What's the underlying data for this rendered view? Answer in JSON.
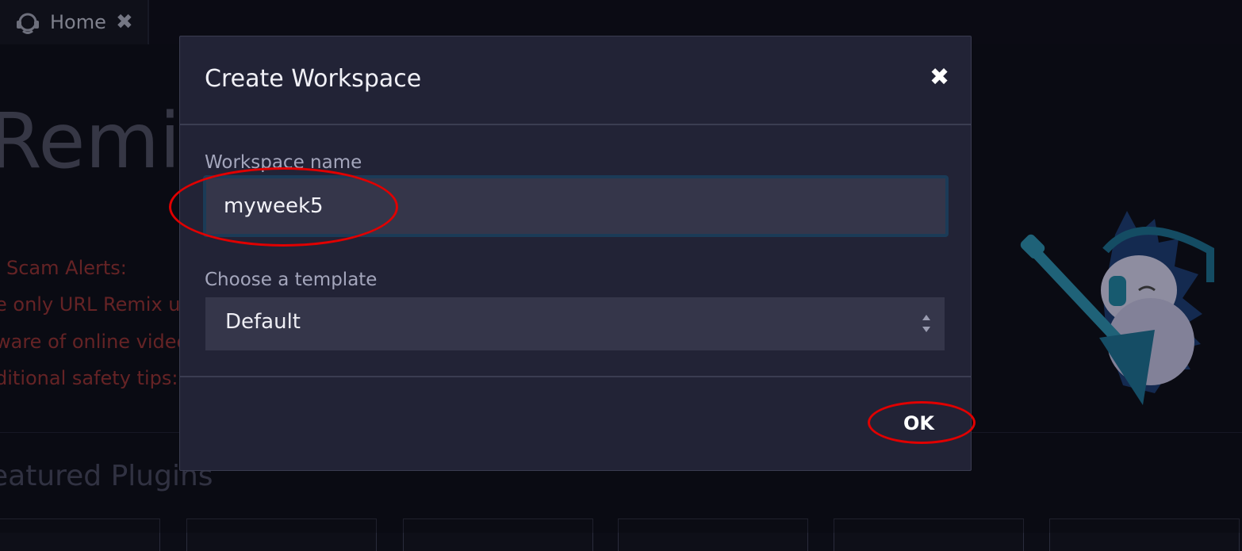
{
  "tab": {
    "label": "Home",
    "close_glyph": "✖",
    "icon": "remix-logo-icon"
  },
  "background": {
    "title": "Remix",
    "alerts": [
      "Scam Alerts:",
      "e only URL Remix us",
      "ware of online video",
      "ditional safety tips:"
    ],
    "featured_heading": "eatured Plugins"
  },
  "modal": {
    "title": "Create Workspace",
    "close_glyph": "✖",
    "name_label": "Workspace name",
    "name_value": "myweek5",
    "template_label": "Choose a template",
    "template_value": "Default",
    "ok_label": "OK"
  },
  "colors": {
    "annotation_red": "#e00000",
    "modal_bg": "#222336",
    "input_bg": "#35364a",
    "alert_text": "#8f3030"
  }
}
